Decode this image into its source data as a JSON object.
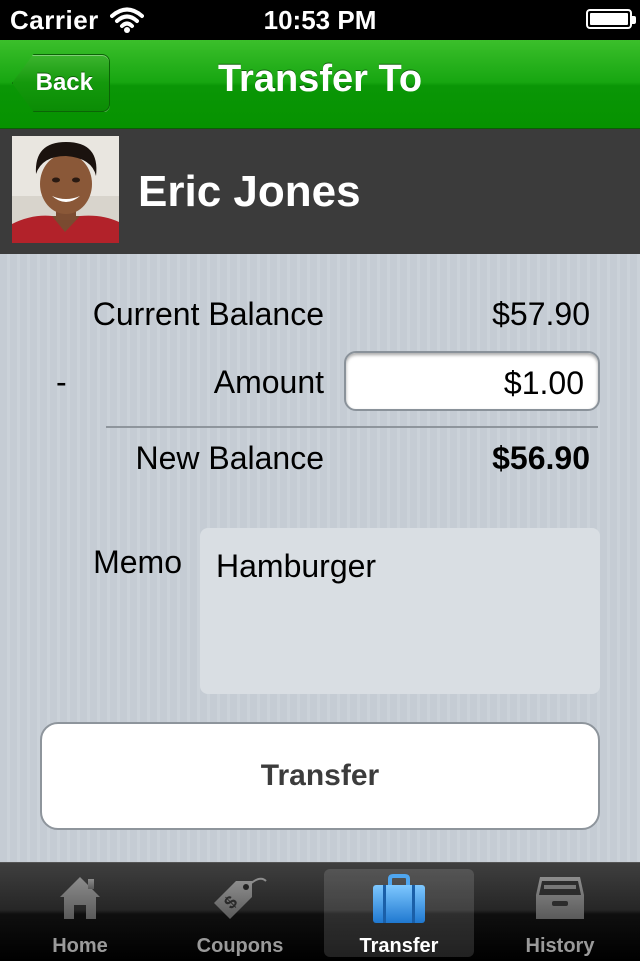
{
  "status_bar": {
    "carrier": "Carrier",
    "time": "10:53 PM"
  },
  "nav": {
    "back_label": "Back",
    "title": "Transfer To"
  },
  "recipient": {
    "name": "Eric Jones"
  },
  "balance": {
    "current_label": "Current Balance",
    "current_value": "$57.90",
    "minus_sign": "-",
    "amount_label": "Amount",
    "amount_value": "$1.00",
    "new_label": "New Balance",
    "new_value": "$56.90"
  },
  "memo": {
    "label": "Memo",
    "value": "Hamburger"
  },
  "transfer_button": "Transfer",
  "tabs": [
    {
      "label": "Home",
      "icon": "house-icon"
    },
    {
      "label": "Coupons",
      "icon": "tag-icon"
    },
    {
      "label": "Transfer",
      "icon": "briefcase-icon",
      "active": true
    },
    {
      "label": "History",
      "icon": "inbox-tray-icon"
    }
  ],
  "colors": {
    "nav_green": "#17a611",
    "profile_bar": "#3b3b3b",
    "content_bg": "#c5ccd4",
    "active_tab_icon": "#2f8fe0"
  }
}
